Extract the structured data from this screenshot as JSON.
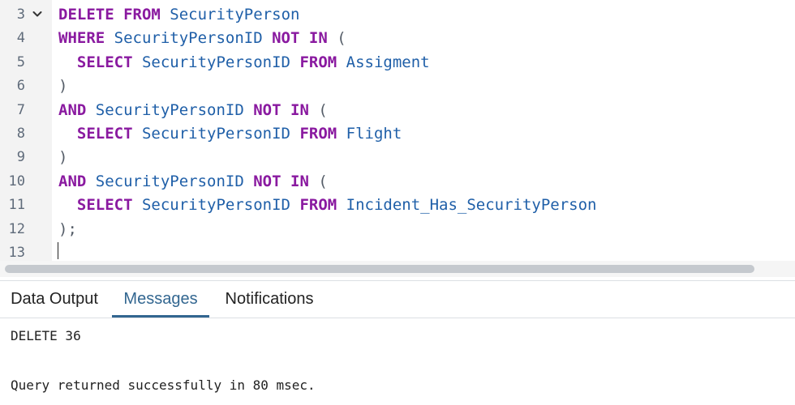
{
  "editor": {
    "lines": [
      {
        "number": "3",
        "fold": true,
        "tokens": [
          {
            "t": "DELETE",
            "c": "kw"
          },
          {
            "t": " ",
            "c": "id"
          },
          {
            "t": "FROM",
            "c": "kw"
          },
          {
            "t": " SecurityPerson",
            "c": "id"
          }
        ]
      },
      {
        "number": "4",
        "fold": false,
        "tokens": [
          {
            "t": "WHERE",
            "c": "kw"
          },
          {
            "t": " SecurityPersonID ",
            "c": "id"
          },
          {
            "t": "NOT",
            "c": "kw"
          },
          {
            "t": " ",
            "c": "id"
          },
          {
            "t": "IN",
            "c": "kw"
          },
          {
            "t": " (",
            "c": "pun"
          }
        ]
      },
      {
        "number": "5",
        "fold": false,
        "tokens": [
          {
            "t": "  ",
            "c": "id"
          },
          {
            "t": "SELECT",
            "c": "kw"
          },
          {
            "t": " SecurityPersonID ",
            "c": "id"
          },
          {
            "t": "FROM",
            "c": "kw"
          },
          {
            "t": " Assigment",
            "c": "id"
          }
        ]
      },
      {
        "number": "6",
        "fold": false,
        "tokens": [
          {
            "t": ")",
            "c": "pun"
          }
        ]
      },
      {
        "number": "7",
        "fold": false,
        "tokens": [
          {
            "t": "AND",
            "c": "kw"
          },
          {
            "t": " SecurityPersonID ",
            "c": "id"
          },
          {
            "t": "NOT",
            "c": "kw"
          },
          {
            "t": " ",
            "c": "id"
          },
          {
            "t": "IN",
            "c": "kw"
          },
          {
            "t": " (",
            "c": "pun"
          }
        ]
      },
      {
        "number": "8",
        "fold": false,
        "tokens": [
          {
            "t": "  ",
            "c": "id"
          },
          {
            "t": "SELECT",
            "c": "kw"
          },
          {
            "t": " SecurityPersonID ",
            "c": "id"
          },
          {
            "t": "FROM",
            "c": "kw"
          },
          {
            "t": " Flight",
            "c": "id"
          }
        ]
      },
      {
        "number": "9",
        "fold": false,
        "tokens": [
          {
            "t": ")",
            "c": "pun"
          }
        ]
      },
      {
        "number": "10",
        "fold": false,
        "tokens": [
          {
            "t": "AND",
            "c": "kw"
          },
          {
            "t": " SecurityPersonID ",
            "c": "id"
          },
          {
            "t": "NOT",
            "c": "kw"
          },
          {
            "t": " ",
            "c": "id"
          },
          {
            "t": "IN",
            "c": "kw"
          },
          {
            "t": " (",
            "c": "pun"
          }
        ]
      },
      {
        "number": "11",
        "fold": false,
        "tokens": [
          {
            "t": "  ",
            "c": "id"
          },
          {
            "t": "SELECT",
            "c": "kw"
          },
          {
            "t": " SecurityPersonID ",
            "c": "id"
          },
          {
            "t": "FROM",
            "c": "kw"
          },
          {
            "t": " Incident_Has_SecurityPerson",
            "c": "id"
          }
        ]
      },
      {
        "number": "12",
        "fold": false,
        "tokens": [
          {
            "t": ");",
            "c": "pun"
          }
        ]
      },
      {
        "number": "13",
        "fold": false,
        "tokens": []
      }
    ],
    "fold_icon": "chevron-down-icon",
    "colors": {
      "keyword": "#8a1aa0",
      "identifier": "#1f5fa8",
      "punctuation": "#555d68",
      "gutter_bg": "#f3f3f3"
    }
  },
  "tabs": {
    "data_output": "Data Output",
    "messages": "Messages",
    "notifications": "Notifications",
    "active": "messages",
    "accent_color": "#326690"
  },
  "messages": {
    "line1": "DELETE 36",
    "line2": "Query returned successfully in 80 msec."
  }
}
